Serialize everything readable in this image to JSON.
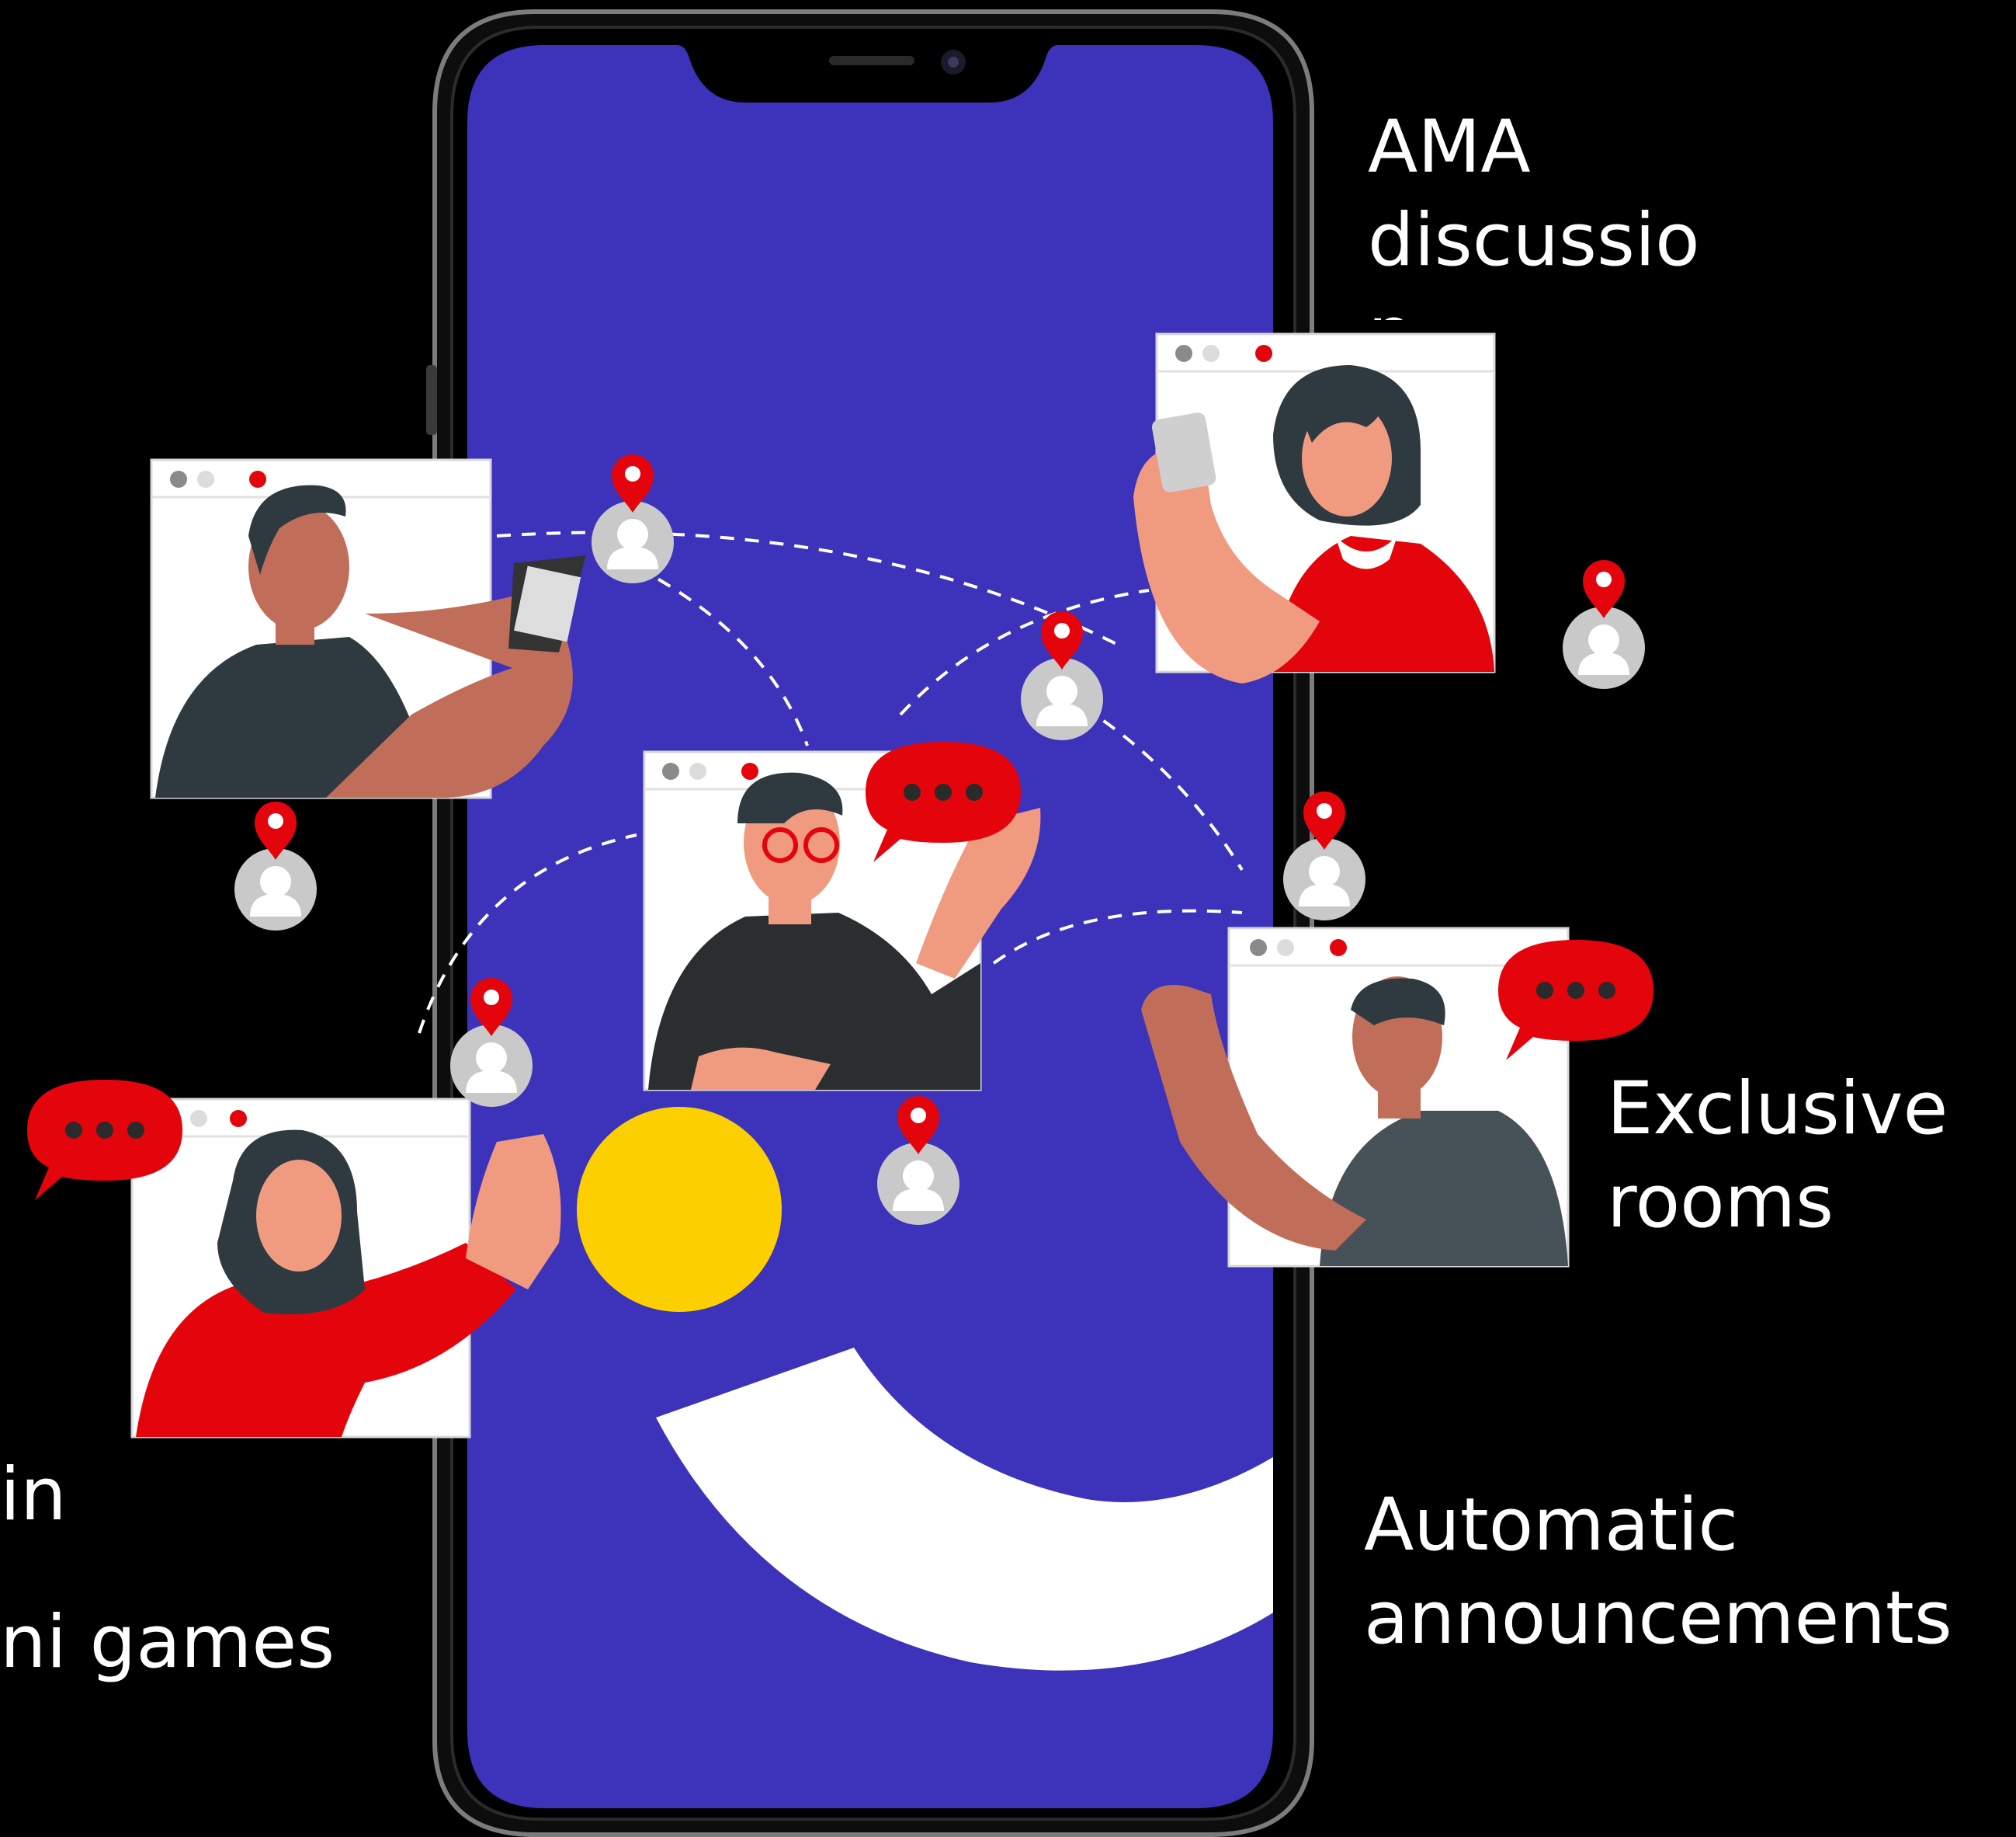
{
  "labels": {
    "ama": {
      "line1": "AMA",
      "line2": "discussio",
      "line3": "n"
    },
    "exclusive": {
      "line1": "Exclusive",
      "line2": "rooms"
    },
    "automatic": {
      "line1": "Automatic",
      "line2": "announcements"
    },
    "left_fragments": {
      "frag1": ")",
      "frag2": "in",
      "frag3": "ni games"
    }
  },
  "colors": {
    "background": "#000000",
    "screen": "#3D33BB",
    "accent_red": "#E3040C",
    "yellow": "#FCD000",
    "skin": "#D37862",
    "dark_shirt": "#2F3A40",
    "text": "#FFFFFF"
  },
  "icons": [
    "location-pin-icon",
    "user-avatar-icon",
    "chat-bubble-icon"
  ]
}
